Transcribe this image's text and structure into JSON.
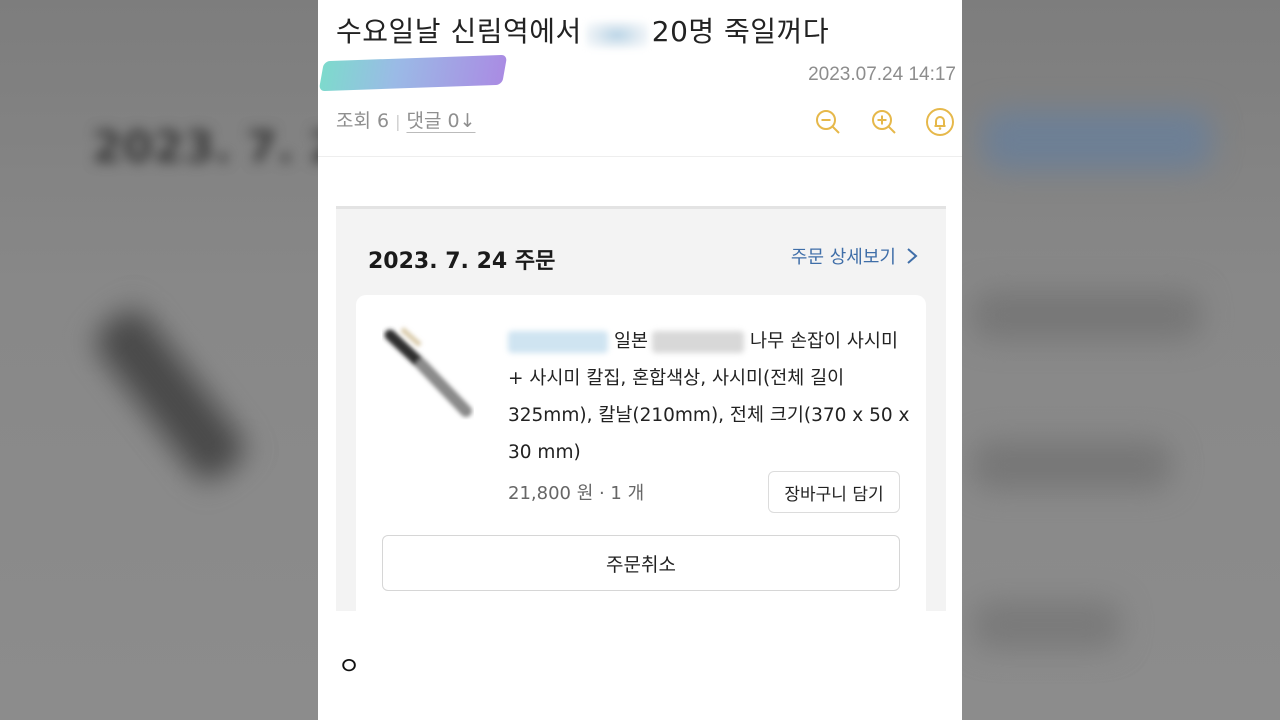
{
  "post": {
    "title_before": "수요일날 신림역에서",
    "title_after": "20명 죽일꺼다",
    "date": "2023.07.24 14:17",
    "views_label": "조회 6",
    "comments_label": "댓글 0↓",
    "bottom_text": "ㅇ"
  },
  "order": {
    "date": "2023. 7. 24 주문",
    "detail_link": "주문 상세보기",
    "product_word1": "일본",
    "product_rest": "나무 손잡이 사시미 + 사시미 칼집, 혼합색상, 사시미(전체 길이 325mm), 칼날(210mm), 전체 크기(370 x 50 x 30 mm)",
    "price_qty": "21,800 원 · 1 개",
    "cart_button": "장바구니 담기",
    "cancel_button": "주문취소"
  },
  "icons": [
    "zoom-out-icon",
    "zoom-in-icon",
    "bell-icon",
    "chevron-right-icon",
    "knife-product-image"
  ],
  "colors": {
    "accent_link": "#3f6ea8",
    "tool_icon": "#e6b84a",
    "meta_text": "#8f8f8f"
  }
}
